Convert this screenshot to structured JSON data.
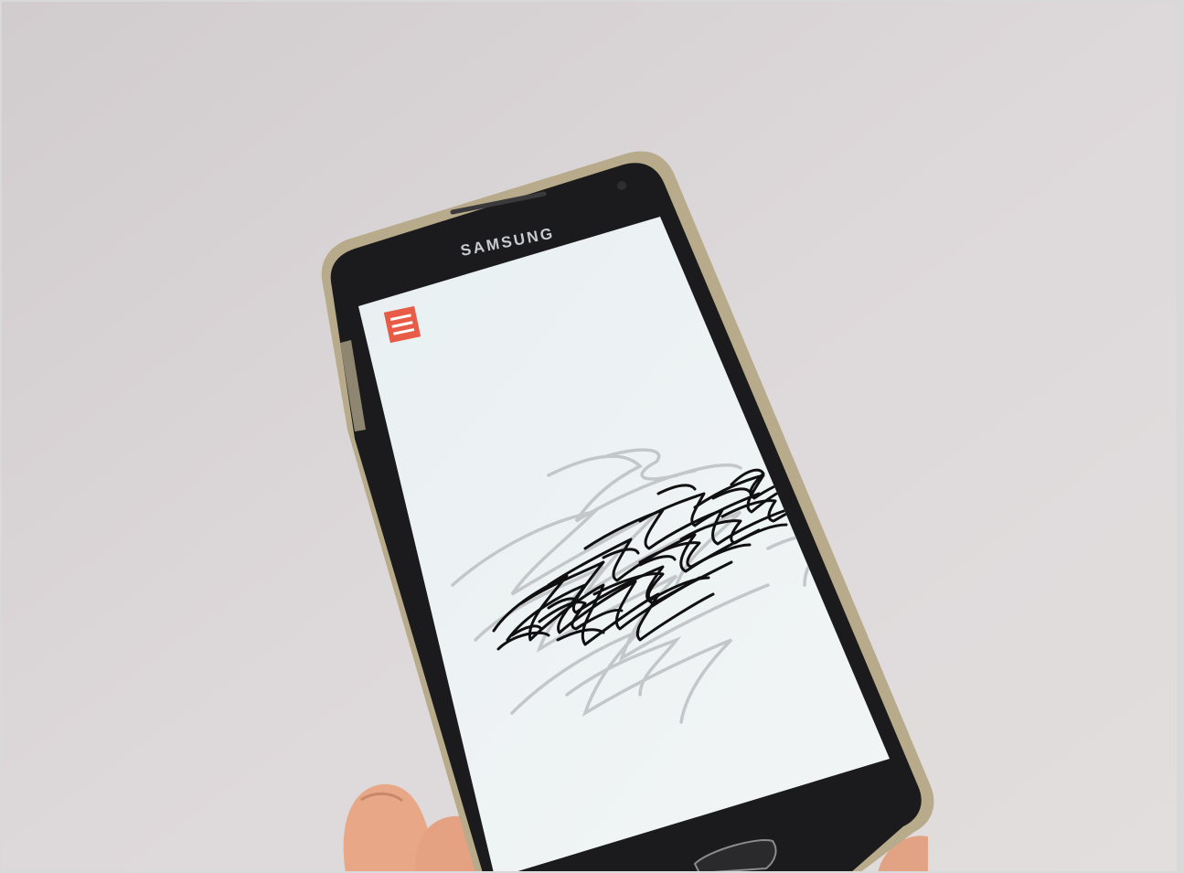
{
  "photo": {
    "subject": "smartphone-held-in-hand",
    "device": {
      "brand_label": "SAMSUNG",
      "frame_color": "#1b1b1d",
      "case_color": "#b5a98a"
    },
    "screen": {
      "background_color": "#eef2f3",
      "menu_button": {
        "icon": "hamburger-menu-icon",
        "color": "#e85b47"
      },
      "scribble_color": "#101010",
      "shadow_scribble_color": "#c6c9cb"
    },
    "wall_color": "#d9d4d8",
    "hand_color": "#e6a889"
  }
}
